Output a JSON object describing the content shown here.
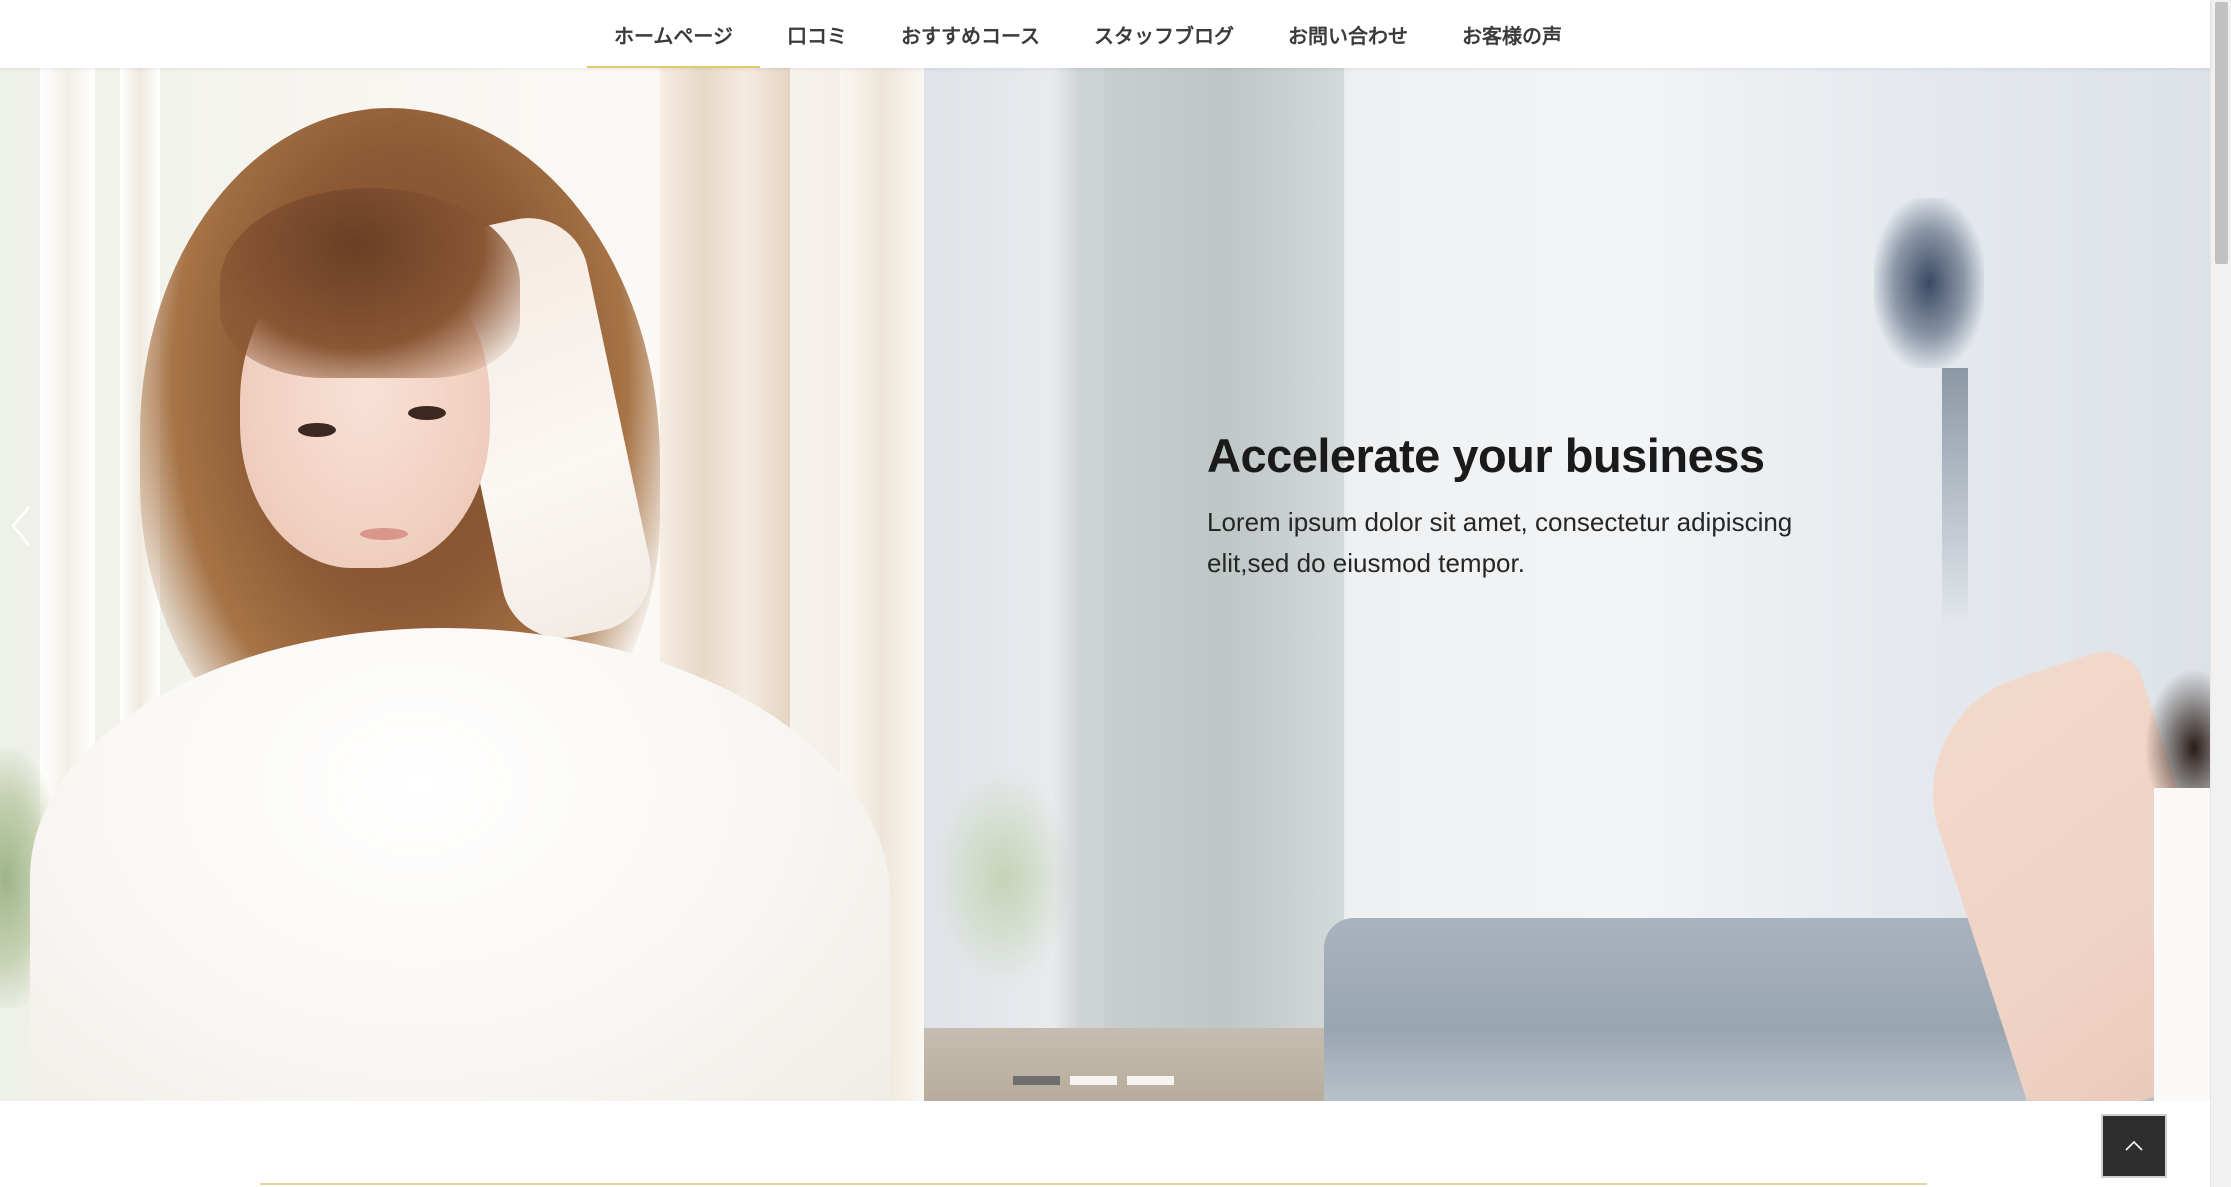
{
  "nav": {
    "items": [
      {
        "label": "ホームページ",
        "active": true
      },
      {
        "label": "口コミ",
        "active": false
      },
      {
        "label": "おすすめコース",
        "active": false
      },
      {
        "label": "スタッフブログ",
        "active": false
      },
      {
        "label": "お問い合わせ",
        "active": false
      },
      {
        "label": "お客様の声",
        "active": false
      }
    ],
    "active_underline_color": "#e8c76a"
  },
  "hero": {
    "title": "Accelerate your business",
    "text": "Lorem ipsum dolor sit amet, consectetur adipiscing elit,sed do eiusmod tempor.",
    "prev_icon": "chevron-left-icon",
    "slide_count": 3,
    "active_slide": 1
  },
  "back_to_top": {
    "icon": "chevron-up-icon"
  },
  "colors": {
    "accent": "#e8c76a",
    "text": "#3b3b3b",
    "indicator_active": "#6f6f6f",
    "back_to_top_bg": "#2e2e2e"
  }
}
